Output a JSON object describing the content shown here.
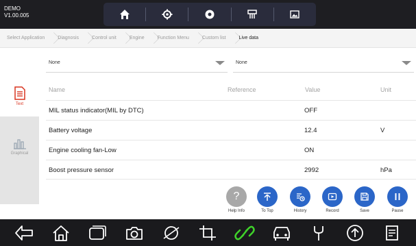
{
  "top": {
    "demo": "DEMO",
    "version": "V1.00.005",
    "nav_icons": [
      "home-icon",
      "settings-icon",
      "record-dot-icon",
      "vci-icon",
      "screenshot-icon"
    ]
  },
  "breadcrumb": [
    "Select Application",
    "Diagnosis",
    "Control unit",
    "Engine",
    "Function Menu",
    "Custom list",
    "Live data"
  ],
  "side": {
    "text_label": "Text",
    "graphical_label": "Graphical"
  },
  "dropdowns": {
    "left": "None",
    "right": "None"
  },
  "table": {
    "headers": {
      "name": "Name",
      "reference": "Reference",
      "value": "Value",
      "unit": "Unit"
    },
    "rows": [
      {
        "name": "MIL status indicator(MIL by DTC)",
        "reference": "",
        "value": "OFF",
        "unit": ""
      },
      {
        "name": "Battery voltage",
        "reference": "",
        "value": "12.4",
        "unit": "V"
      },
      {
        "name": "Engine cooling fan-Low",
        "reference": "",
        "value": "ON",
        "unit": ""
      },
      {
        "name": "Boost pressure sensor",
        "reference": "",
        "value": "2992",
        "unit": "hPa"
      }
    ]
  },
  "actions": [
    {
      "label": "Help Info",
      "icon": "help-icon"
    },
    {
      "label": "To Top",
      "icon": "to-top-icon"
    },
    {
      "label": "History",
      "icon": "history-icon"
    },
    {
      "label": "Record",
      "icon": "record-icon"
    },
    {
      "label": "Save",
      "icon": "save-icon"
    },
    {
      "label": "Pause",
      "icon": "pause-icon"
    }
  ],
  "colors": {
    "accent_blue": "#2b66c8",
    "text_tab_red": "#d9331f",
    "link_green": "#3fd12a"
  }
}
